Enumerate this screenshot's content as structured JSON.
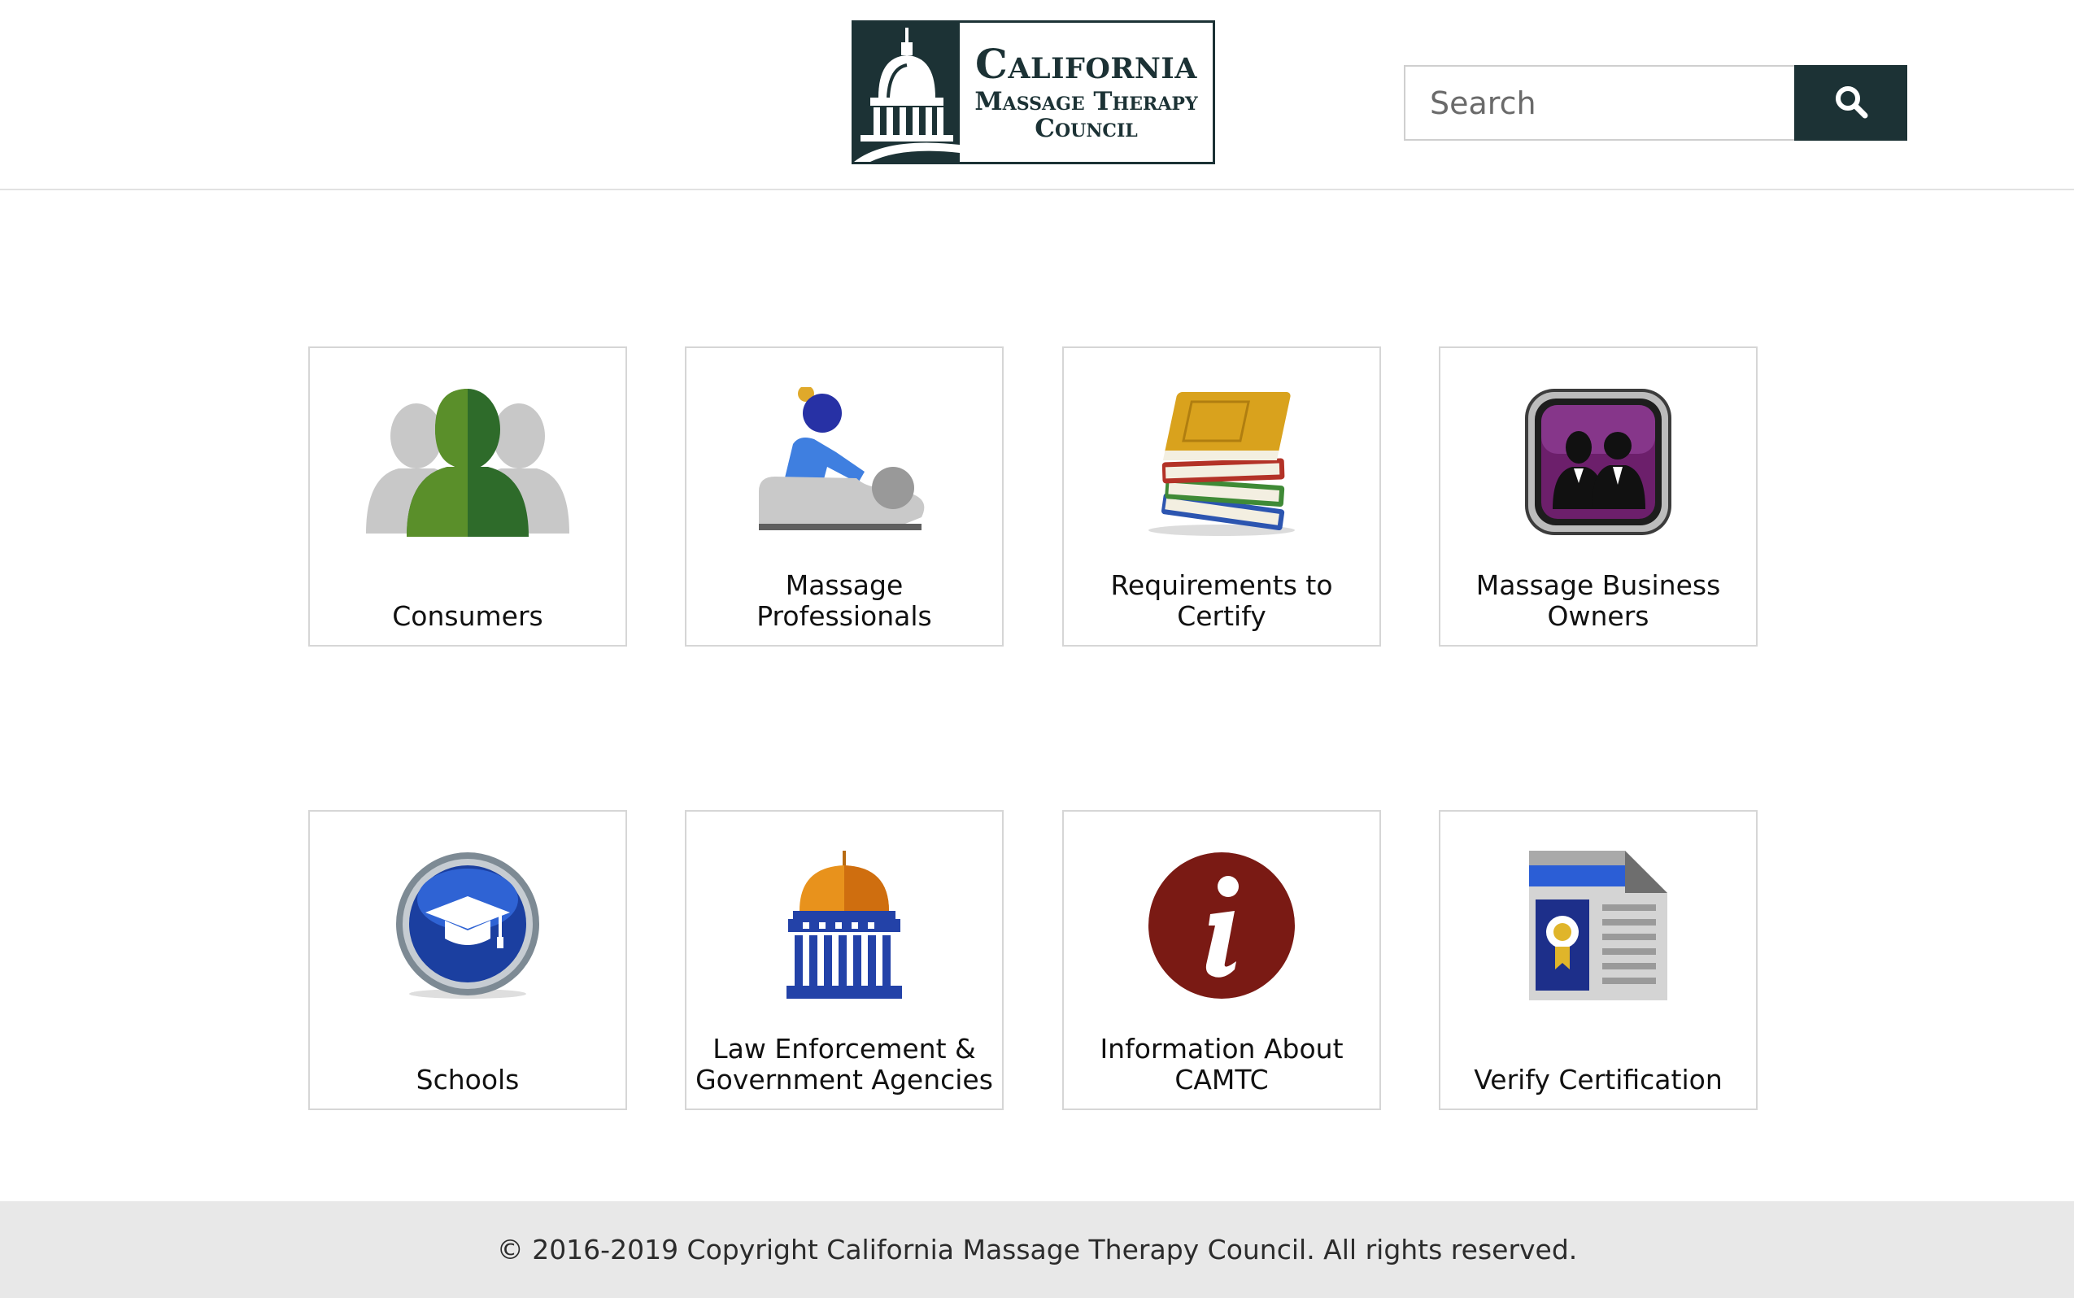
{
  "header": {
    "logo": {
      "line1": "California",
      "line2": "Massage Therapy",
      "line3": "Council",
      "icon": "capitol-dome-emblem"
    },
    "search": {
      "placeholder": "Search",
      "value": "",
      "button_icon": "search-icon"
    }
  },
  "tiles": [
    {
      "label": "Consumers",
      "icon": "consumers-people-icon"
    },
    {
      "label": "Massage Professionals",
      "icon": "massage-therapist-icon"
    },
    {
      "label": "Requirements to Certify",
      "icon": "books-stack-icon"
    },
    {
      "label": "Massage Business Owners",
      "icon": "business-owners-icon"
    },
    {
      "label": "Schools",
      "icon": "graduation-cap-icon"
    },
    {
      "label": "Law Enforcement & Government Agencies",
      "icon": "government-building-icon"
    },
    {
      "label": "Information About CAMTC",
      "icon": "info-icon"
    },
    {
      "label": "Verify Certification",
      "icon": "certificate-icon"
    }
  ],
  "footer": {
    "copyright": "© 2016-2019 Copyright California Massage Therapy Council. All rights reserved."
  },
  "colors": {
    "brand_dark": "#1c3235",
    "tile_border": "#d6d6d6",
    "footer_bg": "#e8e8e8"
  }
}
